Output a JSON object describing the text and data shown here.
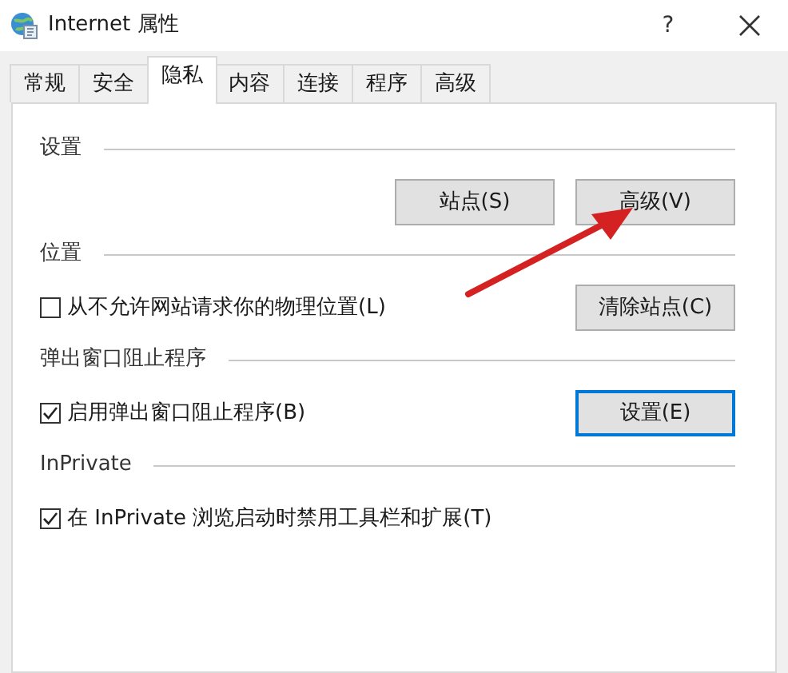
{
  "window": {
    "title": "Internet 属性",
    "help": "?"
  },
  "tabs": [
    {
      "label": "常规",
      "selected": false
    },
    {
      "label": "安全",
      "selected": false
    },
    {
      "label": "隐私",
      "selected": true
    },
    {
      "label": "内容",
      "selected": false
    },
    {
      "label": "连接",
      "selected": false
    },
    {
      "label": "程序",
      "selected": false
    },
    {
      "label": "高级",
      "selected": false
    }
  ],
  "sections": [
    {
      "heading": "设置",
      "buttons": [
        {
          "label": "站点(S)",
          "default": false
        },
        {
          "label": "高级(V)",
          "default": false
        }
      ]
    },
    {
      "heading": "位置",
      "checkbox": {
        "label": "从不允许网站请求你的物理位置(L)",
        "checked": false
      },
      "buttons": [
        {
          "label": "清除站点(C)",
          "default": false
        }
      ]
    },
    {
      "heading": "弹出窗口阻止程序",
      "checkbox": {
        "label": "启用弹出窗口阻止程序(B)",
        "checked": true
      },
      "buttons": [
        {
          "label": "设置(E)",
          "default": true
        }
      ]
    },
    {
      "heading": "InPrivate",
      "checkbox": {
        "label": "在 InPrivate 浏览启动时禁用工具栏和扩展(T)",
        "checked": true
      }
    }
  ]
}
